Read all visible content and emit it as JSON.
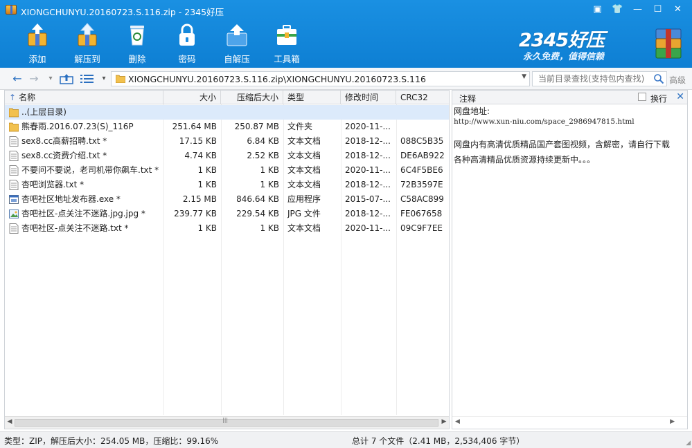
{
  "window": {
    "title": "XIONGCHUNYU.20160723.S.116.zip - 2345好压",
    "buttons": {
      "menu": "▣",
      "skin": "👕",
      "minimize": "—",
      "maximize": "☐",
      "close": "✕"
    }
  },
  "toolbar": {
    "items": [
      {
        "label": "添加",
        "icon": "add-archive-icon"
      },
      {
        "label": "解压到",
        "icon": "extract-icon"
      },
      {
        "label": "删除",
        "icon": "trash-icon"
      },
      {
        "label": "密码",
        "icon": "lock-icon"
      },
      {
        "label": "自解压",
        "icon": "self-extract-icon"
      },
      {
        "label": "工具箱",
        "icon": "toolbox-icon"
      }
    ]
  },
  "brand": {
    "logo": "2345好压",
    "slogan": "永久免费，值得信赖"
  },
  "address": {
    "path": "XIONGCHUNYU.20160723.S.116.zip\\XIONGCHUNYU.20160723.S.116",
    "search_placeholder": "当前目录查找(支持包内查找)",
    "advanced": "高级"
  },
  "filelist": {
    "columns": [
      "名称",
      "大小",
      "压缩后大小",
      "类型",
      "修改时间",
      "CRC32"
    ],
    "sort_arrow": "↑",
    "rows": [
      {
        "name": "..(上层目录)",
        "size": "",
        "packed": "",
        "type": "",
        "modified": "",
        "crc": "",
        "icon": "folder"
      },
      {
        "name": "熊春雨.2016.07.23(S)_116P",
        "size": "251.64 MB",
        "packed": "250.87 MB",
        "type": "文件夹",
        "modified": "2020-11-...",
        "crc": "",
        "icon": "folder"
      },
      {
        "name": "sex8.cc高薪招聘.txt *",
        "size": "17.15 KB",
        "packed": "6.84 KB",
        "type": "文本文档",
        "modified": "2018-12-...",
        "crc": "088C5B35",
        "icon": "txt"
      },
      {
        "name": "sex8.cc资费介绍.txt *",
        "size": "4.74 KB",
        "packed": "2.52 KB",
        "type": "文本文档",
        "modified": "2018-12-...",
        "crc": "DE6AB922",
        "icon": "txt"
      },
      {
        "name": "不要问不要说，老司机带你飙车.txt *",
        "size": "1 KB",
        "packed": "1 KB",
        "type": "文本文档",
        "modified": "2020-11-...",
        "crc": "6C4F5BE6",
        "icon": "txt"
      },
      {
        "name": "杏吧浏览器.txt *",
        "size": "1 KB",
        "packed": "1 KB",
        "type": "文本文档",
        "modified": "2018-12-...",
        "crc": "72B3597E",
        "icon": "txt"
      },
      {
        "name": "杏吧社区地址发布器.exe *",
        "size": "2.15 MB",
        "packed": "846.64 KB",
        "type": "应用程序",
        "modified": "2015-07-...",
        "crc": "C58AC899",
        "icon": "exe"
      },
      {
        "name": "杏吧社区-点关注不迷路.jpg.jpg *",
        "size": "239.77 KB",
        "packed": "229.54 KB",
        "type": "JPG 文件",
        "modified": "2018-12-...",
        "crc": "FE067658",
        "icon": "jpg"
      },
      {
        "name": "杏吧社区-点关注不迷路.txt *",
        "size": "1 KB",
        "packed": "1 KB",
        "type": "文本文档",
        "modified": "2020-11-...",
        "crc": "09C9F7EE",
        "icon": "txt"
      }
    ]
  },
  "notes": {
    "title": "注释",
    "wrap_label": "换行",
    "line1": "网盘地址:",
    "url": "http://www.xun-niu.com/space_2986947815.html",
    "para1": "网盘内有高清优质精品国产套图视频，含解密，请自行下载",
    "para2": "各种高清精品优质资源持续更新中。。。"
  },
  "status": {
    "left": "类型：ZIP，解压后大小：254.05 MB，压缩比：99.16%",
    "right": "总计 7 个文件（2.41 MB，2,534,406 字节）"
  },
  "colors": {
    "accent": "#1a8be0",
    "selection": "#dceafb"
  }
}
